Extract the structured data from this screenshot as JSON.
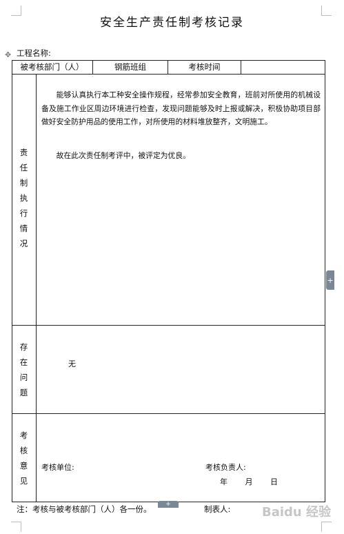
{
  "title": "安全生产责任制考核记录",
  "project_label": "工程名称:",
  "header": {
    "dept_label": "被考核部门（人）",
    "dept_value": "钢筋班组",
    "time_label": "考核时间",
    "time_value": ""
  },
  "sections": {
    "duty": {
      "label_chars": [
        "责",
        "任",
        "制",
        "执",
        "行",
        "情",
        "况"
      ],
      "paragraph_1": "能够认真执行本工种安全操作规程，经常参加安全教育，班前对所使用的机械设备及施工作业区周边环境进行检查，发现问题能够及时上报或解决，积极协助项目部做好安全防护用品的使用工作，对所使用的材料堆放整齐，文明施工。",
      "paragraph_2": "故在此次责任制考评中，被评定为优良。"
    },
    "issues": {
      "label_chars": [
        "存",
        "在",
        "问",
        "题"
      ],
      "value": "无"
    },
    "opinion": {
      "label_chars": [
        "考",
        "核",
        "意",
        "见"
      ],
      "unit_label": "考核单位:",
      "responsible_label": "考核负责人:",
      "date_text": "年 月 日"
    }
  },
  "footer": {
    "note": "注：考核与被考核部门（人）各一份。",
    "maker_label": "制表人:"
  },
  "watermark_text": "Baidu 经验"
}
